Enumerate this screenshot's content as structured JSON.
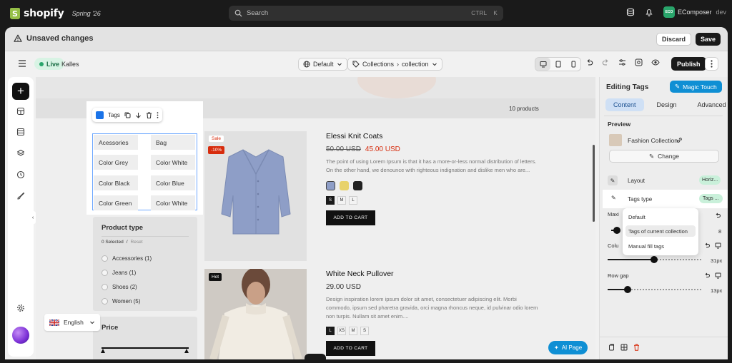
{
  "topbar": {
    "logo": "shopify",
    "logo_glyph": "S",
    "edition": "Spring '26",
    "search_placeholder": "Search",
    "shortcut_ctrl": "CTRL",
    "shortcut_key": "K",
    "store_initials": "ECO",
    "store_name": "EComposer",
    "store_env": "dev"
  },
  "unsaved_bar": {
    "title": "Unsaved changes",
    "discard": "Discard",
    "save": "Save"
  },
  "toolbar": {
    "live": "Live",
    "theme": "Kalles",
    "language": "Default",
    "breadcrumb_root": "Collections",
    "breadcrumb_leaf": "collection",
    "publish": "Publish"
  },
  "canvas": {
    "product_count": "10 products",
    "tags_widget_label": "Tags",
    "tags": [
      "Acessories",
      "Bag",
      "Color Grey",
      "Color White",
      "Color Black",
      "Color Blue",
      "Color Green",
      "Color White"
    ],
    "filter_title": "Product type",
    "filter_selected": "0 Selected",
    "filter_sep": "/",
    "filter_reset": "Reset",
    "filter_options": [
      "Accessories (1)",
      "Jeans (1)",
      "Shoes (2)",
      "Women (5)"
    ],
    "price_title": "Price",
    "language_label": "English",
    "ai_button": "AI Page",
    "products": [
      {
        "badge_sale": "Sale",
        "badge_discount": "-10%",
        "title": "Elessi Knit Coats",
        "old_price": "50.00 USD",
        "price": "45.00 USD",
        "description": "The point of using Lorem Ipsum is that it has a more-or-less normal distribution of letters. On the other hand, we denounce with righteous indignation and dislike men who are...",
        "sizes": [
          "S",
          "M",
          "L"
        ],
        "selected_size": "S",
        "cta": "ADD TO CART"
      },
      {
        "badge_hot": "Hot",
        "title": "White Neck Pullover",
        "price": "29.00 USD",
        "description": "Design inspiration lorem ipsum dolor sit amet, consectetuer adipiscing elit. Morbi commodo, ipsum sed pharetra gravida, orci magna rhoncus neque, id pulvinar odio lorem non turpis. Nullam sit amet enim....",
        "sizes": [
          "L",
          "XS",
          "M",
          "S"
        ],
        "selected_size": "L",
        "cta": "ADD TO CART"
      }
    ]
  },
  "panel": {
    "title": "Editing Tags",
    "magic": "Magic Touch",
    "tabs": [
      "Content",
      "Design",
      "Advanced"
    ],
    "active_tab": "Content",
    "preview_label": "Preview",
    "collection_name": "Fashion Collection",
    "change_button": "Change",
    "layout_label": "Layout",
    "layout_value": "Horiz...",
    "tags_type_label": "Tags type",
    "tags_type_value": "Tags ...",
    "max_label": "Maxi",
    "max_value": "8",
    "column_label": "Colu",
    "column_value": "31px",
    "row_gap_label": "Row gap",
    "row_gap_value": "13px",
    "dropdown_options": [
      "Default",
      "Tags of current collection",
      "Manual fill tags"
    ],
    "dropdown_selected": "Tags of current collection"
  },
  "colors": {
    "accent_blue": "#1a73e8",
    "live_green": "#29a56b",
    "sale_red": "#d72c0d",
    "magic_button": "#0f8fd4",
    "pill_green": "#c9f0da"
  }
}
